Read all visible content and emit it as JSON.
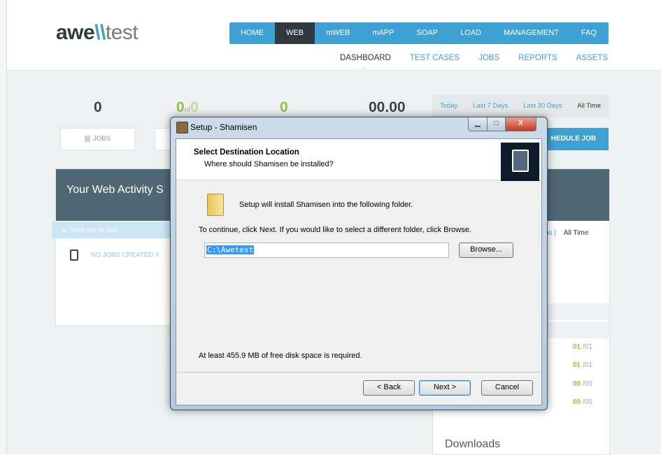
{
  "site": {
    "logo": {
      "a": "awe",
      "slash": "\\\\",
      "b": "test"
    },
    "topnav": [
      "HOME",
      "WEB",
      "mWEB",
      "mAPP",
      "SOAP",
      "LOAD",
      "MANAGEMENT",
      "FAQ"
    ],
    "topnav_active": "WEB",
    "subnav": [
      "DASHBOARD",
      "TEST CASES",
      "JOBS",
      "REPORTS",
      "ASSETS"
    ],
    "subnav_active": "DASHBOARD",
    "stats": {
      "jobs": "0",
      "passed": "0",
      "of": "of",
      "total": "0",
      "third": "0",
      "time": "00.00"
    },
    "jobs_label": "JOBS",
    "time_filter": [
      "Today",
      "Last 7 Days",
      "Last 30 Days",
      "All Time"
    ],
    "time_filter_active": "All Time",
    "schedule_button": "HEDULE JOB",
    "activity_title": "Your Web Activity S",
    "no_jobs_tip": "There are no jobs",
    "no_jobs_row": "NO JOBS CREATED Y",
    "right_filter": {
      "partial": "hs",
      "active": "All Time"
    },
    "right_values": [
      {
        "v": "01",
        "t": "/01"
      },
      {
        "v": "01",
        "t": "/01"
      },
      {
        "v": "00",
        "t": "/00"
      },
      {
        "v": "00",
        "t": "/00"
      }
    ],
    "downloads": "Downloads"
  },
  "dialog": {
    "title": "Setup - Shamisen",
    "controls": {
      "minimize": "▁",
      "maximize": "□",
      "close": "X"
    },
    "heading": "Select Destination Location",
    "subheading": "Where should Shamisen be installed?",
    "line1": "Setup will install Shamisen into the following folder.",
    "line2": "To continue, click Next. If you would like to select a different folder, click Browse.",
    "path": "C:\\Awetest",
    "browse": "Browse...",
    "disk_space": "At least 455.9 MB of free disk space is required.",
    "back": "< Back",
    "next": "Next >",
    "cancel": "Cancel"
  },
  "colors": {
    "accent": "#3fa0d3",
    "dark": "#2f3a40",
    "green": "#8cc63f",
    "panel": "#4f6775"
  }
}
